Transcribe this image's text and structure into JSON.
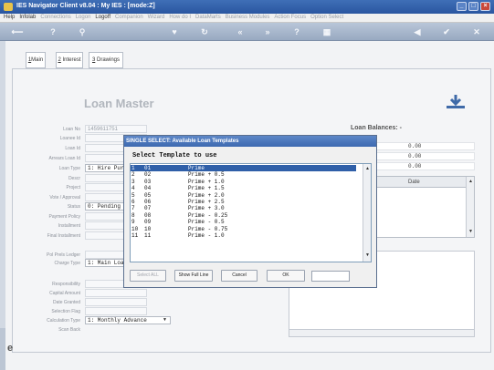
{
  "window": {
    "title": "IES Navigator Client v8.04 : My IES :      [mode:Z]"
  },
  "menubar": {
    "items": [
      "Help",
      "Infolab",
      "Connections",
      "Logon",
      "Logoff",
      "Companion",
      "Wizard",
      "How do I",
      "DataMarts",
      "Business Modules",
      "Action Focus",
      "Option Select"
    ],
    "disabled": [
      false,
      false,
      true,
      true,
      false,
      true,
      true,
      true,
      true,
      true,
      true,
      true
    ]
  },
  "tabs": [
    {
      "key": "1",
      "label": "Main"
    },
    {
      "key": "2",
      "label": "Interest"
    },
    {
      "key": "3",
      "label": "Drawings"
    }
  ],
  "page": {
    "heading": "Loan Master"
  },
  "form": {
    "loan_no": {
      "label": "Loan No",
      "value": "1459611751"
    },
    "loanee_id": {
      "label": "Loanee Id"
    },
    "loan_id": {
      "label": "Loan Id"
    },
    "arrears_loan_id": {
      "label": "Arrears Loan Id"
    },
    "loan_type": {
      "label": "Loan Type",
      "value": "1: Hire Pur"
    },
    "descr": {
      "label": "Descr"
    },
    "project": {
      "label": "Project"
    },
    "vote_approval": {
      "label": "Vote / Approval"
    },
    "status": {
      "label": "Status",
      "value": "0: Pending"
    },
    "payment_policy": {
      "label": "Payment Policy"
    },
    "installment": {
      "label": "Installment"
    },
    "final_installment": {
      "label": "Final Installment"
    },
    "pol_prels_ledger": {
      "label": "Pol Prels Ledger"
    },
    "charge_type": {
      "label": "Charge Type",
      "value": "1: Main Loa"
    },
    "responsibility": {
      "label": "Responsibility"
    },
    "capital_amount": {
      "label": "Capital Amount"
    },
    "date_granted": {
      "label": "Date Granted"
    },
    "selection_flag": {
      "label": "Selection Flag"
    },
    "calculation_type": {
      "label": "Calculation Type",
      "value": "1: Monthly Advance"
    },
    "scan_back": {
      "label": "Scan Back"
    }
  },
  "balances": {
    "title": "Loan Balances: -",
    "values": [
      "0.00",
      "0.00",
      "0.00"
    ],
    "grid_header": "Date"
  },
  "dialog": {
    "title": "SINGLE SELECT: Available Loan Templates",
    "subtitle": "Select Template to use",
    "rows": [
      {
        "n": "1",
        "code": "01",
        "name": "Prime"
      },
      {
        "n": "2",
        "code": "02",
        "name": "Prime + 0.5"
      },
      {
        "n": "3",
        "code": "03",
        "name": "Prime + 1.0"
      },
      {
        "n": "4",
        "code": "04",
        "name": "Prime + 1.5"
      },
      {
        "n": "5",
        "code": "05",
        "name": "Prime + 2.0"
      },
      {
        "n": "6",
        "code": "06",
        "name": "Prime + 2.5"
      },
      {
        "n": "7",
        "code": "07",
        "name": "Prime + 3.0"
      },
      {
        "n": "8",
        "code": "08",
        "name": "Prime - 0.25"
      },
      {
        "n": "9",
        "code": "09",
        "name": "Prime - 0.5"
      },
      {
        "n": "10",
        "code": "10",
        "name": "Prime - 0.75"
      },
      {
        "n": "11",
        "code": "11",
        "name": "Prime - 1.0"
      }
    ],
    "selected_index": 0,
    "buttons": {
      "select_all": "Select ALL",
      "show_full_line": "Show Full Line",
      "cancel": "Cancel",
      "ok": "OK"
    }
  },
  "colors": {
    "title_bar": "#2a56a0",
    "selection": "#2f5fa8",
    "toolbar": "#98a9c1"
  }
}
